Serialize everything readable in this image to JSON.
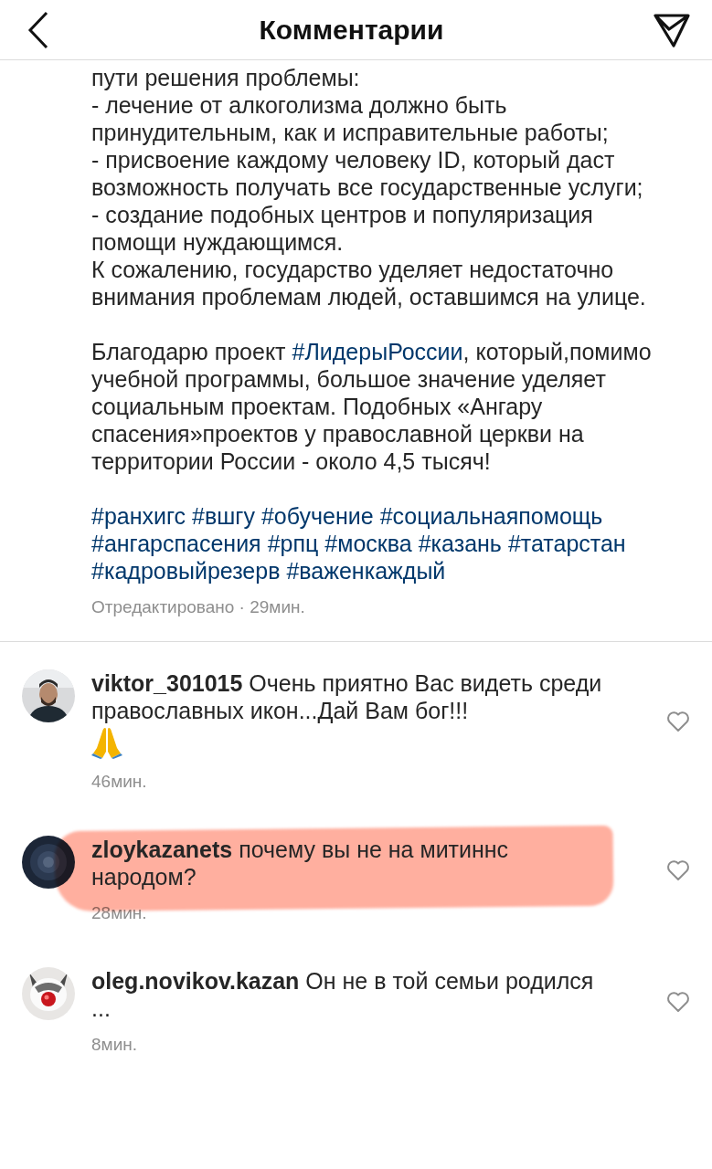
{
  "header": {
    "title": "Комментарии"
  },
  "post": {
    "paragraphs": [
      {
        "kind": "line",
        "parts": [
          {
            "kind": "text",
            "text": "пути решения проблемы:"
          }
        ]
      },
      {
        "kind": "line",
        "parts": [
          {
            "kind": "text",
            "text": "- лечение от алкоголизма должно быть принудительным, как и исправительные работы;"
          }
        ]
      },
      {
        "kind": "line",
        "parts": [
          {
            "kind": "text",
            "text": "- присвоение каждому человеку ID, который даст возможность получать все государственные услуги;"
          }
        ]
      },
      {
        "kind": "line",
        "parts": [
          {
            "kind": "text",
            "text": "- создание подобных центров и популяризация помощи нуждающимся."
          }
        ]
      },
      {
        "kind": "line",
        "parts": [
          {
            "kind": "text",
            "text": "К сожалению, государство уделяет недостаточно внимания проблемам людей, оставшимся на улице."
          }
        ]
      },
      {
        "kind": "block",
        "parts": [
          {
            "kind": "text",
            "text": "Благодарю проект "
          },
          {
            "kind": "hashtag",
            "text": "#ЛидерыРоссии"
          },
          {
            "kind": "text",
            "text": ", который,помимо учебной программы, большое значение уделяет социальным проектам. Подобных «Ангару спасения»проектов у православной церкви на территории России - около 4,5 тысяч!"
          }
        ]
      },
      {
        "kind": "block",
        "parts": [
          {
            "kind": "hashtag",
            "text": "#ранхигс"
          },
          {
            "kind": "hashtag",
            "text": "#вшгу"
          },
          {
            "kind": "hashtag",
            "text": "#обучение"
          },
          {
            "kind": "hashtag",
            "text": "#социальнаяпомощь"
          },
          {
            "kind": "hashtag",
            "text": "#ангарспасения"
          },
          {
            "kind": "hashtag",
            "text": "#рпц"
          },
          {
            "kind": "hashtag",
            "text": "#москва"
          },
          {
            "kind": "hashtag",
            "text": "#казань"
          },
          {
            "kind": "hashtag",
            "text": "#татарстан"
          },
          {
            "kind": "hashtag",
            "text": "#кадровыйрезерв"
          },
          {
            "kind": "hashtag",
            "text": "#важенкаждый"
          }
        ]
      }
    ],
    "meta": "Отредактировано · 29мин."
  },
  "comments": [
    {
      "text": "**viktor_301015** Очень приятно Вас видеть среди православных икон...Дай Вам бог!!!",
      "emoji_icon": true,
      "time": "46мин.",
      "highlighted": false,
      "liked": false
    },
    {
      "text": "**zloykazanets** почему вы не на митиннс народом?",
      "time": "28мин.",
      "highlighted": true,
      "liked": false
    },
    {
      "text": "**oleg.novikov.kazan** Он не в той семьи родился ...",
      "time": "8мин.",
      "highlighted": false,
      "liked": false
    }
  ]
}
